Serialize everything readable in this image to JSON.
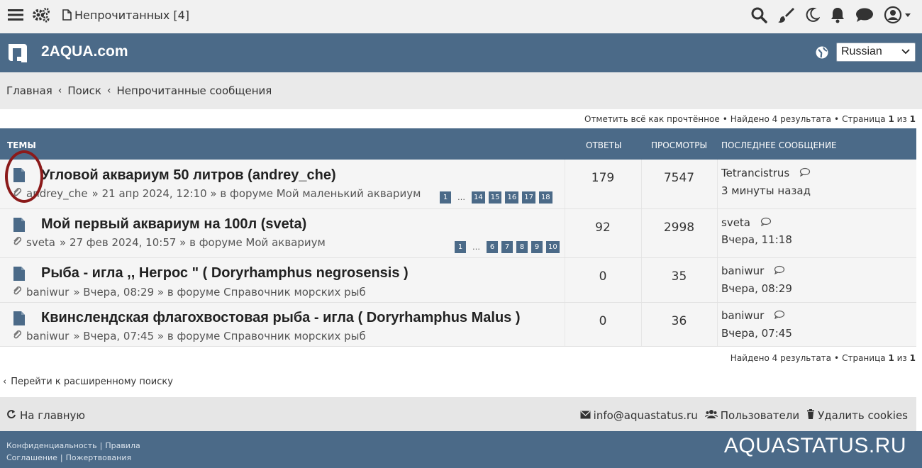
{
  "topbar": {
    "menu_icon": "hamburger-icon",
    "settings_icon": "gear-icon",
    "unread_label": "Непрочитанных [4]",
    "right_icons": [
      "search-icon",
      "brush-icon",
      "moon-icon",
      "bell-icon",
      "chat-icon",
      "user-icon"
    ]
  },
  "header": {
    "site_name": "2AQUA.com",
    "language": "Russian"
  },
  "breadcrumb": [
    "Главная",
    "Поиск",
    "Непрочитанные сообщения"
  ],
  "pagination_top": {
    "mark_read": "Отметить всё как прочтённое",
    "found": "Найдено 4 результата",
    "page_prefix": "Страница",
    "page": "1",
    "of": "из",
    "total": "1"
  },
  "table": {
    "headers": {
      "topics": "ТЕМЫ",
      "replies": "ОТВЕТЫ",
      "views": "ПРОСМОТРЫ",
      "last": "ПОСЛЕДНЕЕ СООБЩЕНИЕ"
    },
    "rows": [
      {
        "title": "Угловой аквариум 50 литров (andrey_che)",
        "author": "andrey_che",
        "meta": "» 21 апр 2024, 12:10 » в форуме Мой маленький аквариум",
        "pages": [
          "1",
          "…",
          "14",
          "15",
          "16",
          "17",
          "18"
        ],
        "replies": "179",
        "views": "7547",
        "last_author": "Tetrancistrus",
        "last_time": "3 минуты назад"
      },
      {
        "title": "Мой первый аквариум на 100л (sveta)",
        "author": "sveta",
        "meta": "» 27 фев 2024, 10:57 » в форуме Мой аквариум",
        "pages": [
          "1",
          "…",
          "6",
          "7",
          "8",
          "9",
          "10"
        ],
        "replies": "92",
        "views": "2998",
        "last_author": "sveta",
        "last_time": "Вчера, 11:18"
      },
      {
        "title": "Рыба - игла ,, Негрос \" ( Doryrhamphus negrosensis )",
        "author": "baniwur",
        "meta": "» Вчера, 08:29 » в форуме Справочник морских рыб",
        "pages": [],
        "replies": "0",
        "views": "35",
        "last_author": "baniwur",
        "last_time": "Вчера, 08:29"
      },
      {
        "title": "Квинслендская флагохвостовая рыба - игла ( Doryrhamphus Malus )",
        "author": "baniwur",
        "meta": "» Вчера, 07:45 » в форуме Справочник морских рыб",
        "pages": [],
        "replies": "0",
        "views": "36",
        "last_author": "baniwur",
        "last_time": "Вчера, 07:45"
      }
    ]
  },
  "pagination_bottom": {
    "found": "Найдено 4 результата",
    "page_prefix": "Страница",
    "page": "1",
    "of": "из",
    "total": "1"
  },
  "advanced_search": "Перейти к расширенному поиску",
  "footer_bar": {
    "home": "На главную",
    "email": "info@aquastatus.ru",
    "users": "Пользователи",
    "delete_cookies": "Удалить cookies"
  },
  "footer": {
    "privacy": "Конфиденциальность",
    "rules": "Правила",
    "agreement": "Соглашение",
    "donations": "Пожертвования",
    "brand": "AQUASTATUS.RU"
  },
  "colors": {
    "header_bg": "#4b6a88",
    "page_button": "#4b6a88",
    "highlight_circle": "#8b1a1a"
  }
}
